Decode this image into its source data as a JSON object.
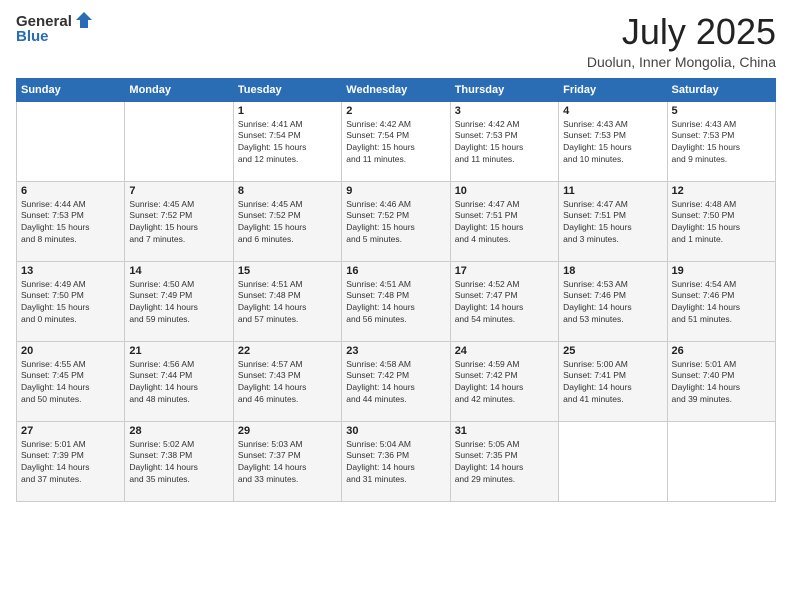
{
  "header": {
    "logo_general": "General",
    "logo_blue": "Blue",
    "month_title": "July 2025",
    "location": "Duolun, Inner Mongolia, China"
  },
  "weekdays": [
    "Sunday",
    "Monday",
    "Tuesday",
    "Wednesday",
    "Thursday",
    "Friday",
    "Saturday"
  ],
  "weeks": [
    [
      {
        "day": "",
        "info": ""
      },
      {
        "day": "",
        "info": ""
      },
      {
        "day": "1",
        "info": "Sunrise: 4:41 AM\nSunset: 7:54 PM\nDaylight: 15 hours\nand 12 minutes."
      },
      {
        "day": "2",
        "info": "Sunrise: 4:42 AM\nSunset: 7:54 PM\nDaylight: 15 hours\nand 11 minutes."
      },
      {
        "day": "3",
        "info": "Sunrise: 4:42 AM\nSunset: 7:53 PM\nDaylight: 15 hours\nand 11 minutes."
      },
      {
        "day": "4",
        "info": "Sunrise: 4:43 AM\nSunset: 7:53 PM\nDaylight: 15 hours\nand 10 minutes."
      },
      {
        "day": "5",
        "info": "Sunrise: 4:43 AM\nSunset: 7:53 PM\nDaylight: 15 hours\nand 9 minutes."
      }
    ],
    [
      {
        "day": "6",
        "info": "Sunrise: 4:44 AM\nSunset: 7:53 PM\nDaylight: 15 hours\nand 8 minutes."
      },
      {
        "day": "7",
        "info": "Sunrise: 4:45 AM\nSunset: 7:52 PM\nDaylight: 15 hours\nand 7 minutes."
      },
      {
        "day": "8",
        "info": "Sunrise: 4:45 AM\nSunset: 7:52 PM\nDaylight: 15 hours\nand 6 minutes."
      },
      {
        "day": "9",
        "info": "Sunrise: 4:46 AM\nSunset: 7:52 PM\nDaylight: 15 hours\nand 5 minutes."
      },
      {
        "day": "10",
        "info": "Sunrise: 4:47 AM\nSunset: 7:51 PM\nDaylight: 15 hours\nand 4 minutes."
      },
      {
        "day": "11",
        "info": "Sunrise: 4:47 AM\nSunset: 7:51 PM\nDaylight: 15 hours\nand 3 minutes."
      },
      {
        "day": "12",
        "info": "Sunrise: 4:48 AM\nSunset: 7:50 PM\nDaylight: 15 hours\nand 1 minute."
      }
    ],
    [
      {
        "day": "13",
        "info": "Sunrise: 4:49 AM\nSunset: 7:50 PM\nDaylight: 15 hours\nand 0 minutes."
      },
      {
        "day": "14",
        "info": "Sunrise: 4:50 AM\nSunset: 7:49 PM\nDaylight: 14 hours\nand 59 minutes."
      },
      {
        "day": "15",
        "info": "Sunrise: 4:51 AM\nSunset: 7:48 PM\nDaylight: 14 hours\nand 57 minutes."
      },
      {
        "day": "16",
        "info": "Sunrise: 4:51 AM\nSunset: 7:48 PM\nDaylight: 14 hours\nand 56 minutes."
      },
      {
        "day": "17",
        "info": "Sunrise: 4:52 AM\nSunset: 7:47 PM\nDaylight: 14 hours\nand 54 minutes."
      },
      {
        "day": "18",
        "info": "Sunrise: 4:53 AM\nSunset: 7:46 PM\nDaylight: 14 hours\nand 53 minutes."
      },
      {
        "day": "19",
        "info": "Sunrise: 4:54 AM\nSunset: 7:46 PM\nDaylight: 14 hours\nand 51 minutes."
      }
    ],
    [
      {
        "day": "20",
        "info": "Sunrise: 4:55 AM\nSunset: 7:45 PM\nDaylight: 14 hours\nand 50 minutes."
      },
      {
        "day": "21",
        "info": "Sunrise: 4:56 AM\nSunset: 7:44 PM\nDaylight: 14 hours\nand 48 minutes."
      },
      {
        "day": "22",
        "info": "Sunrise: 4:57 AM\nSunset: 7:43 PM\nDaylight: 14 hours\nand 46 minutes."
      },
      {
        "day": "23",
        "info": "Sunrise: 4:58 AM\nSunset: 7:42 PM\nDaylight: 14 hours\nand 44 minutes."
      },
      {
        "day": "24",
        "info": "Sunrise: 4:59 AM\nSunset: 7:42 PM\nDaylight: 14 hours\nand 42 minutes."
      },
      {
        "day": "25",
        "info": "Sunrise: 5:00 AM\nSunset: 7:41 PM\nDaylight: 14 hours\nand 41 minutes."
      },
      {
        "day": "26",
        "info": "Sunrise: 5:01 AM\nSunset: 7:40 PM\nDaylight: 14 hours\nand 39 minutes."
      }
    ],
    [
      {
        "day": "27",
        "info": "Sunrise: 5:01 AM\nSunset: 7:39 PM\nDaylight: 14 hours\nand 37 minutes."
      },
      {
        "day": "28",
        "info": "Sunrise: 5:02 AM\nSunset: 7:38 PM\nDaylight: 14 hours\nand 35 minutes."
      },
      {
        "day": "29",
        "info": "Sunrise: 5:03 AM\nSunset: 7:37 PM\nDaylight: 14 hours\nand 33 minutes."
      },
      {
        "day": "30",
        "info": "Sunrise: 5:04 AM\nSunset: 7:36 PM\nDaylight: 14 hours\nand 31 minutes."
      },
      {
        "day": "31",
        "info": "Sunrise: 5:05 AM\nSunset: 7:35 PM\nDaylight: 14 hours\nand 29 minutes."
      },
      {
        "day": "",
        "info": ""
      },
      {
        "day": "",
        "info": ""
      }
    ]
  ]
}
